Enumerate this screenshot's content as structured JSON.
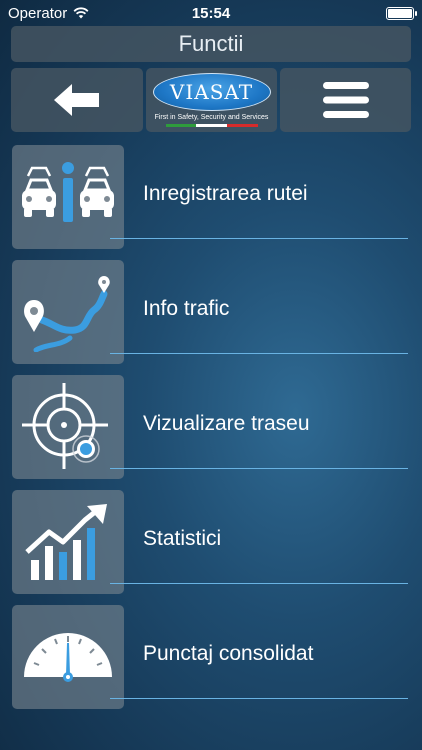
{
  "status_bar": {
    "carrier": "Operator",
    "time": "15:54"
  },
  "header": {
    "title": "Functii"
  },
  "toolbar": {
    "back_icon": "arrow-left-icon",
    "menu_icon": "hamburger-icon",
    "logo": {
      "brand": "VIASAT",
      "tagline": "First in Safety, Security and Services"
    }
  },
  "menu": [
    {
      "label": "Inregistrarea rutei",
      "icon": "cars-info-icon"
    },
    {
      "label": "Info trafic",
      "icon": "map-route-icon"
    },
    {
      "label": "Vizualizare traseu",
      "icon": "target-location-icon"
    },
    {
      "label": "Statistici",
      "icon": "bar-chart-icon"
    },
    {
      "label": "Punctaj consolidat",
      "icon": "gauge-icon"
    }
  ],
  "colors": {
    "accent": "#69b3e3",
    "icon_blue": "#3b9de0"
  }
}
